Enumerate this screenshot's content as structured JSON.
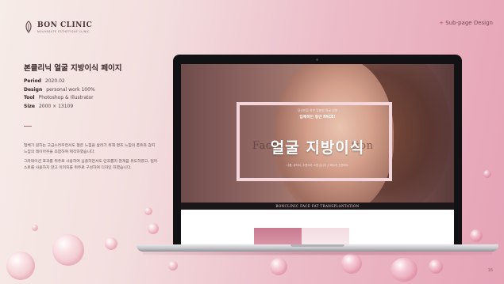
{
  "brand": {
    "name": "BON CLINIC",
    "sub": "NOUVEAUTE ESTHETIQUE CLINIC",
    "seal": "보 몸 미"
  },
  "header": {
    "subpage_prefix": "+",
    "subpage_label": "Sub-page Design"
  },
  "project": {
    "title": "본클리닉 얼굴 지방이식 페이지",
    "period_label": "Period",
    "period_value": "2020.02",
    "design_label": "Design",
    "design_value": "personal work 100%",
    "tool_label": "Tool",
    "tool_value": "Photoshop & Illustrator",
    "size_label": "Size",
    "size_value": "2000 × 13109",
    "divider": "—",
    "description": [
      "업체가 원하는 고급스러우면서도 젊은 느낌을 살리기 위해 명조 느낌의 폰트와 감지 느낌의 레이아웃을 조합하여 제작하였습니다.",
      "그라데이션 효과를 위주로 사용하여 심플하면서도 단조롭지 않게끔 유도하였고, 일러스트를 사용하지 않고 이미지를 위주로 구성하여 디자인 하였습니다."
    ]
  },
  "mockup": {
    "tagline_small": "당신만을 위한 맞춤형 얼굴 성형",
    "tagline_main": "입체적인 동안 FACE!",
    "ghost_left": "Face",
    "ghost_right": "tion",
    "headline": "얼굴 지방이식",
    "subdesc": "나를, 뷰티더, 주름사라 소원 입니다 // 빠르게 진행해요",
    "bar_text": "BONCLINIC FACE FAT TRANSPLANTATION"
  },
  "page_number": "16",
  "colors": {
    "accent": "#b3596f",
    "background_start": "#f6ece8",
    "background_end": "#e6a3b6"
  }
}
